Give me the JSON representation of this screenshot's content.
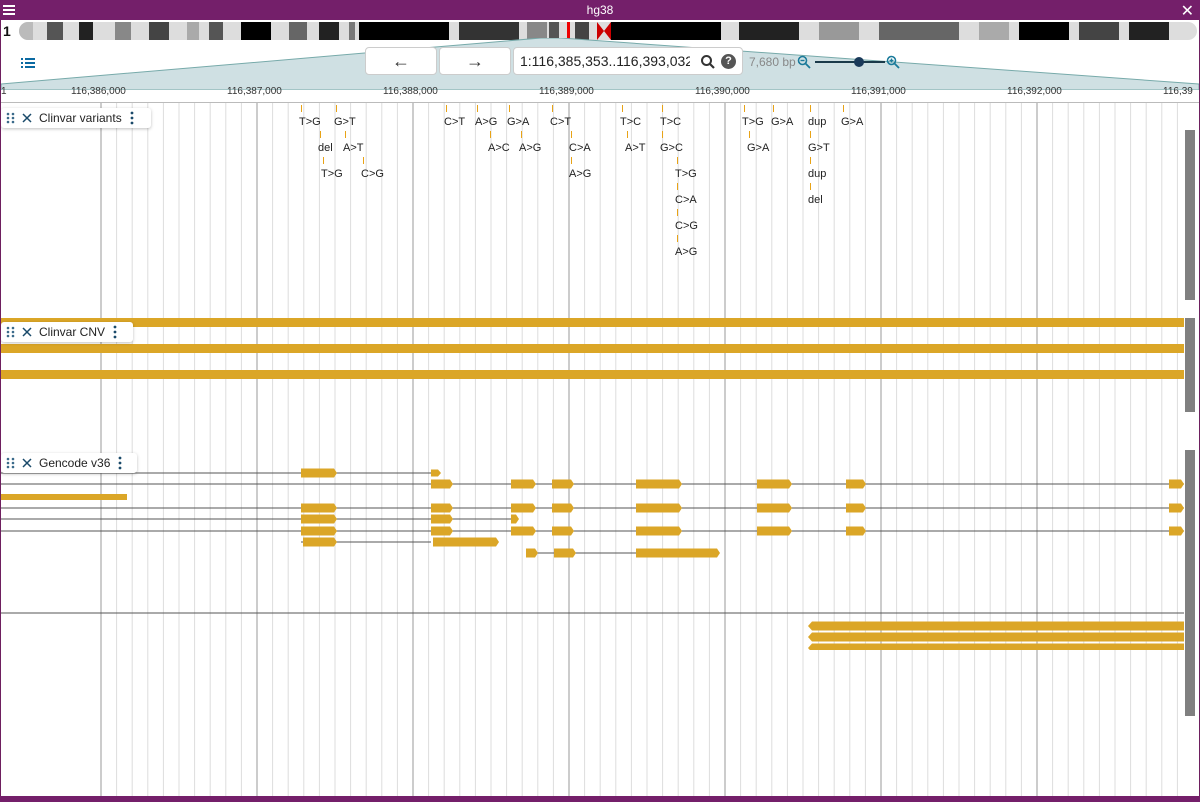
{
  "title": "hg38",
  "chromosome": "1",
  "location": "1:116,385,353..116,393,032",
  "bp_width": "7,680 bp",
  "ruler_ticks": [
    "116,386,000",
    "116,387,000",
    "116,388,000",
    "116,389,000",
    "116,390,000",
    "116,391,000",
    "116,392,000",
    "116,39"
  ],
  "ruler_start": "1",
  "tracks": {
    "variants": "Clinvar variants",
    "cnv": "Clinvar CNV",
    "gencode": "Gencode v36"
  },
  "variants": [
    {
      "t": "T>G"
    },
    {
      "t": "G>T"
    },
    {
      "t": "del"
    },
    {
      "t": "A>T"
    },
    {
      "t": "T>G"
    },
    {
      "t": "C>G"
    },
    {
      "t": "C>T"
    },
    {
      "t": "A>G"
    },
    {
      "t": "G>A"
    },
    {
      "t": "A>C"
    },
    {
      "t": "A>G"
    },
    {
      "t": "C>T"
    },
    {
      "t": "C>A"
    },
    {
      "t": "A>G"
    },
    {
      "t": "T>C"
    },
    {
      "t": "A>T"
    },
    {
      "t": "T>C"
    },
    {
      "t": "G>C"
    },
    {
      "t": "T>G"
    },
    {
      "t": "C>A"
    },
    {
      "t": "C>G"
    },
    {
      "t": "A>G"
    },
    {
      "t": "T>G"
    },
    {
      "t": "G>A"
    },
    {
      "t": "G>A"
    },
    {
      "t": "dup"
    },
    {
      "t": "G>T"
    },
    {
      "t": "dup"
    },
    {
      "t": "del"
    },
    {
      "t": "G>A"
    }
  ],
  "colors": {
    "accent": "#741f6a",
    "feature": "#dba627",
    "variant_tick": "#e8a317"
  },
  "icons": [
    "menu-icon",
    "close-icon",
    "tracklist-icon",
    "arrow-left-icon",
    "arrow-right-icon",
    "search-icon",
    "help-icon",
    "zoom-out-icon",
    "zoom-in-icon",
    "drag-handle-icon",
    "track-close-icon",
    "track-menu-icon"
  ]
}
